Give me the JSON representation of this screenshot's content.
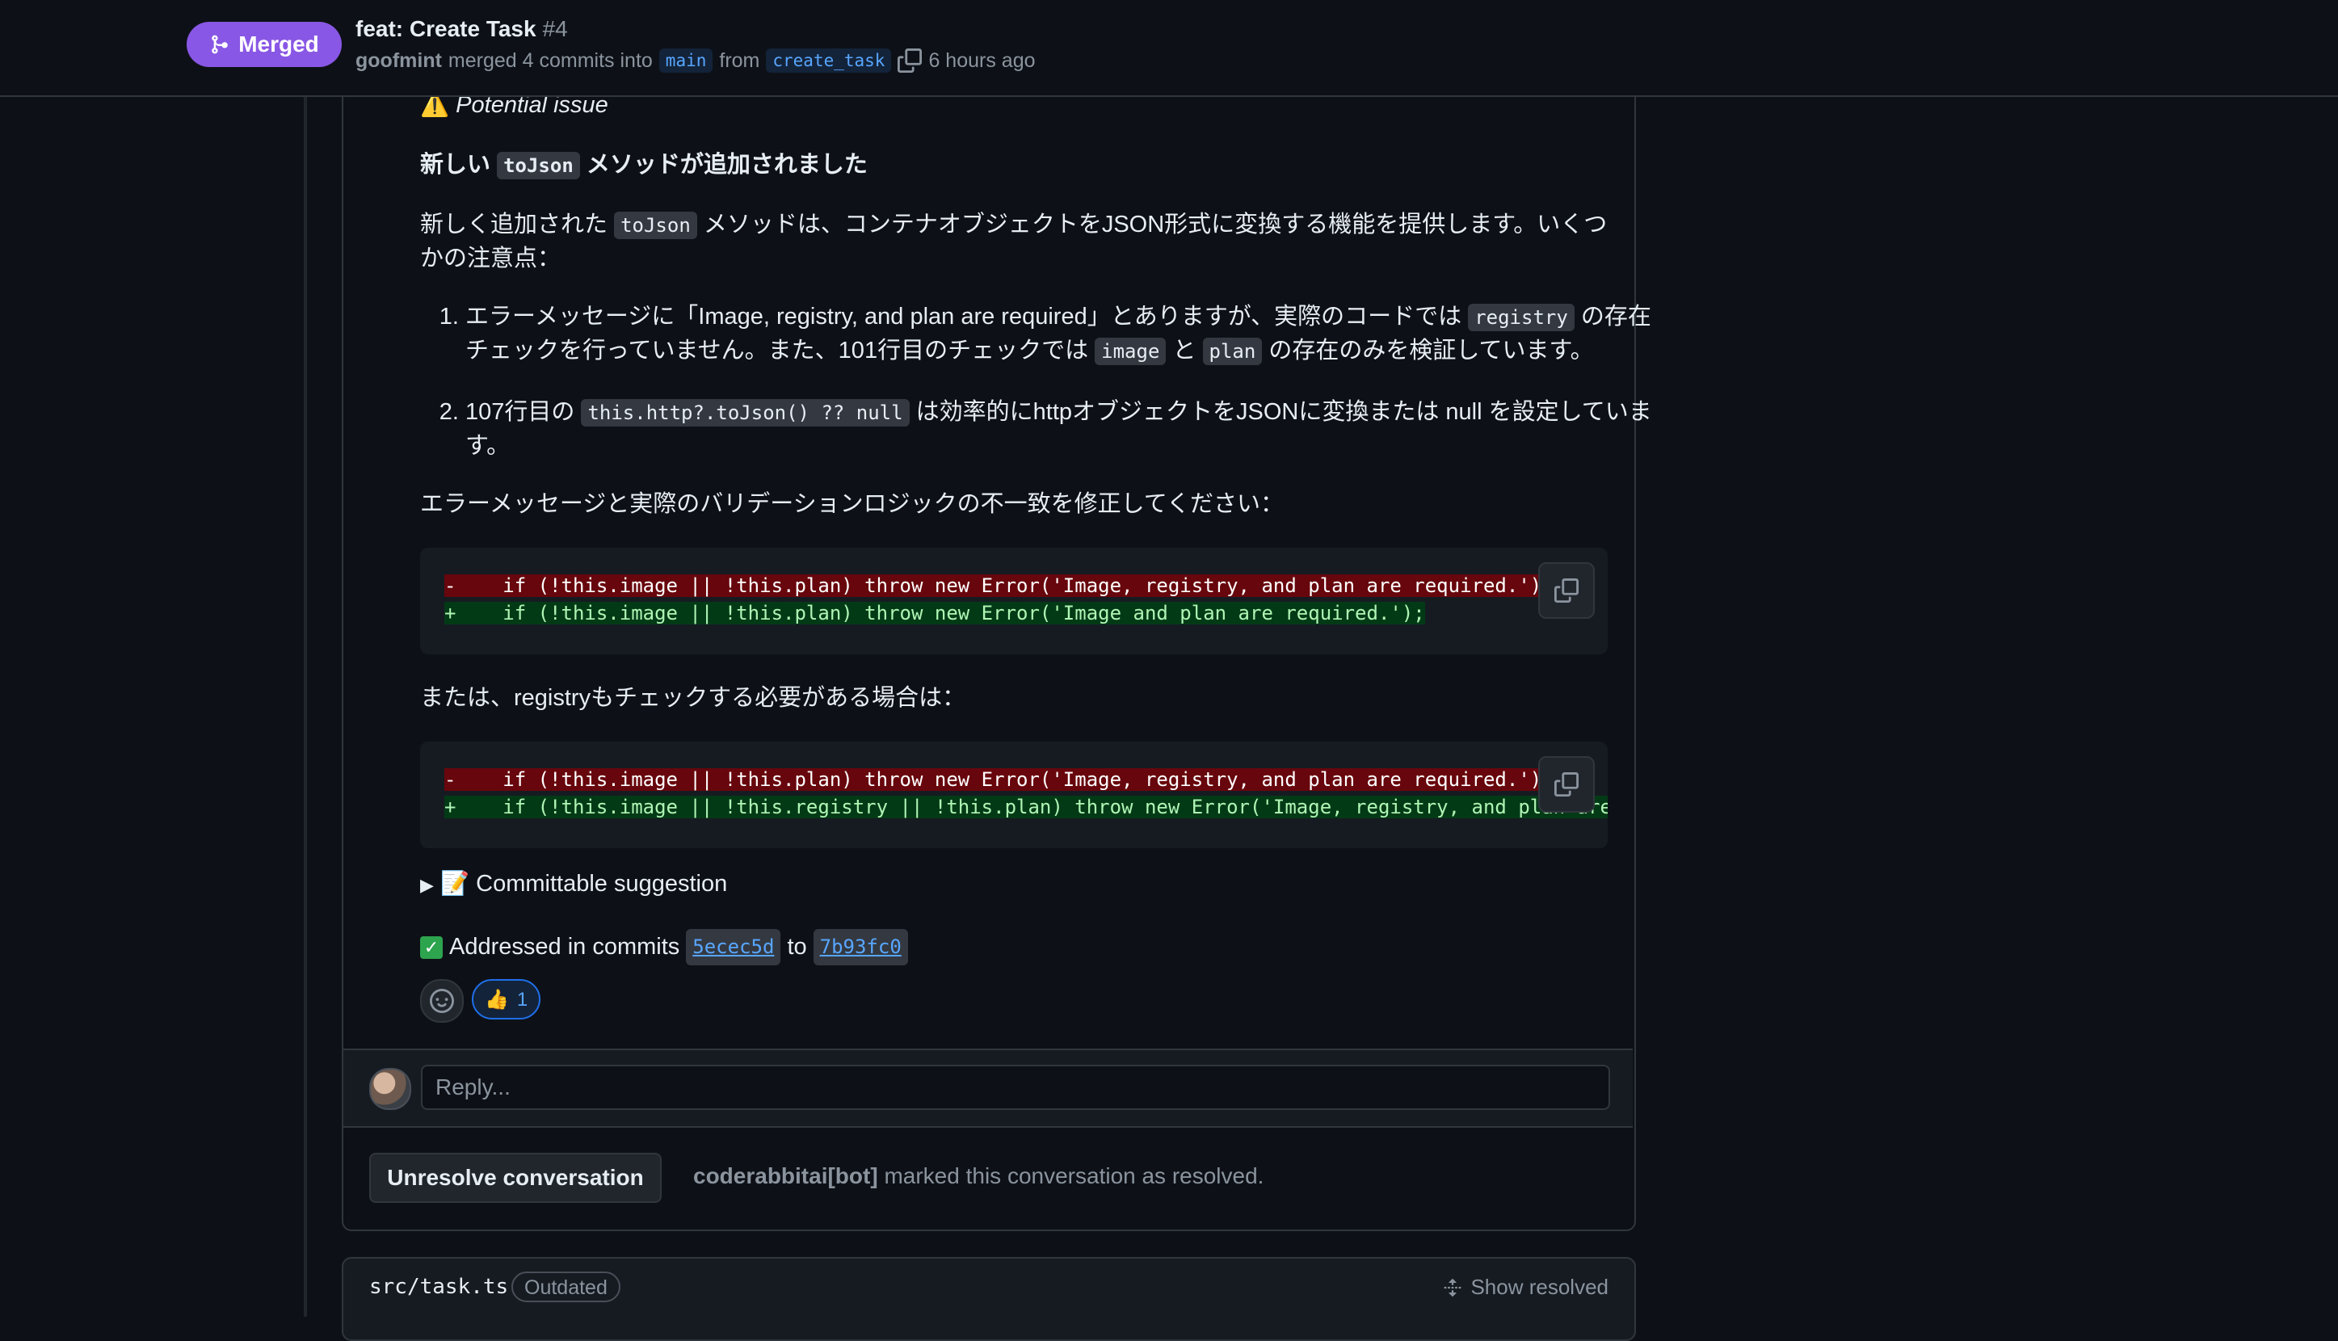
{
  "header": {
    "state": "Merged",
    "title": "feat: Create Task",
    "number": "#4",
    "author": "goofmint",
    "merged_text": "merged 4 commits into",
    "base_branch": "main",
    "from_text": "from",
    "head_branch": "create_task",
    "time": "6 hours ago"
  },
  "comment": {
    "issue_label": "Potential issue",
    "heading_pre": "新しい",
    "heading_code": "toJson",
    "heading_post": "メソッドが追加されました",
    "desc_pre": "新しく追加された",
    "desc_code": "toJson",
    "desc_post": "メソッドは、コンテナオブジェクトをJSON形式に変換する機能を提供します。いくつかの注意点：",
    "item1_a": "エラーメッセージに「Image, registry, and plan are required」とありますが、実際のコードでは",
    "item1_code1": "registry",
    "item1_b": "の存在チェックを行っていません。また、101行目のチェックでは",
    "item1_code2": "image",
    "item1_c": "と",
    "item1_code3": "plan",
    "item1_d": "の存在のみを検証しています。",
    "item2_a": "107行目の",
    "item2_code": "this.http?.toJson() ?? null",
    "item2_b": "は効率的にhttpオブジェクトをJSONに変換または null を設定しています。",
    "fix_text": "エラーメッセージと実際のバリデーションロジックの不一致を修正してください：",
    "diff1_del": "-    if (!this.image || !this.plan) throw new Error('Image, registry, and plan are required.');",
    "diff1_add": "+    if (!this.image || !this.plan) throw new Error('Image and plan are required.');",
    "alt_text": "または、registryもチェックする必要がある場合は：",
    "diff2_del": "-    if (!this.image || !this.plan) throw new Error('Image, registry, and plan are required.');",
    "diff2_add": "+    if (!this.image || !this.registry || !this.plan) throw new Error('Image, registry, and plan are required.');",
    "suggestion_label": "Committable suggestion",
    "addressed_text": "Addressed in commits",
    "sha_from": "5ecec5d",
    "to_text": "to",
    "sha_to": "7b93fc0",
    "thumbs_count": "1"
  },
  "reply": {
    "placeholder": "Reply..."
  },
  "resolution": {
    "button_label": "Unresolve conversation",
    "actor": "coderabbitai[bot]",
    "message": "marked this conversation as resolved."
  },
  "next_file": {
    "path": "src/task.ts",
    "badge": "Outdated",
    "show_resolved": "Show resolved"
  },
  "colors": {
    "merged": "#8957e5",
    "link": "#58a6ff",
    "deletion_bg": "#67060c",
    "addition_bg": "#033a16"
  }
}
